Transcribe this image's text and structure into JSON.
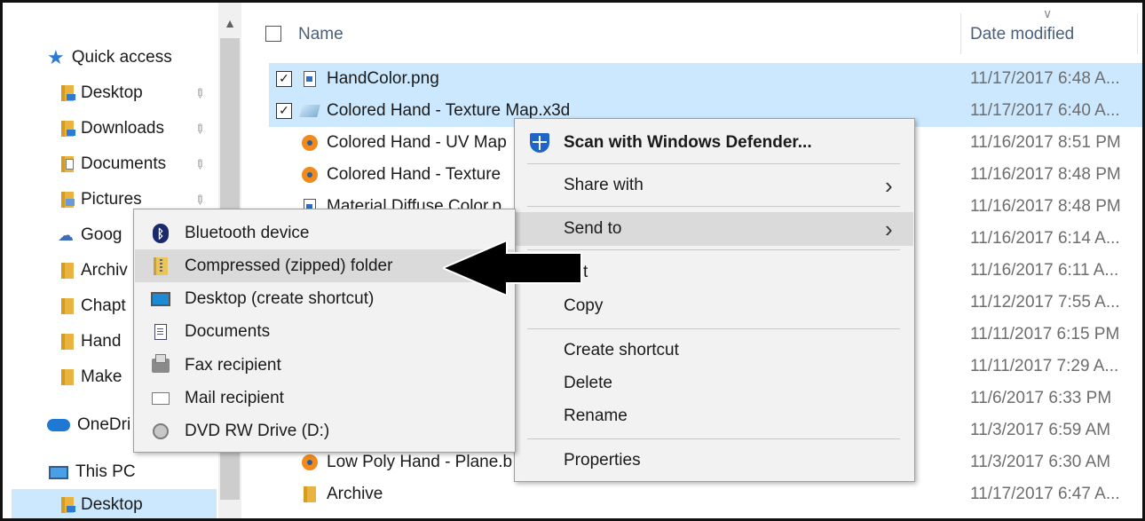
{
  "sidebar": {
    "quick_access": "Quick access",
    "items": [
      {
        "label": "Desktop",
        "pinned": true
      },
      {
        "label": "Downloads",
        "pinned": true
      },
      {
        "label": "Documents",
        "pinned": true
      },
      {
        "label": "Pictures",
        "pinned": true
      },
      {
        "label": "Goog"
      },
      {
        "label": "Archiv"
      },
      {
        "label": "Chapt"
      },
      {
        "label": "Hand"
      },
      {
        "label": "Make"
      }
    ],
    "onedrive": "OneDri",
    "this_pc": "This PC",
    "pc_desktop": "Desktop"
  },
  "header": {
    "name": "Name",
    "date_modified": "Date modified"
  },
  "files": [
    {
      "name": "HandColor.png",
      "date": "11/17/2017 6:48 A...",
      "selected": true,
      "icon": "png-icon"
    },
    {
      "name": "Colored Hand - Texture Map.x3d",
      "date": "11/17/2017 6:40 A...",
      "selected": true,
      "icon": "x3d-icon"
    },
    {
      "name": "Colored Hand - UV Map",
      "date": "11/16/2017 8:51 PM",
      "icon": "blender-icon"
    },
    {
      "name": "Colored Hand - Texture",
      "date": "11/16/2017 8:48 PM",
      "icon": "blender-icon"
    },
    {
      "name": "Material Diffuse Color.p",
      "date": "11/16/2017 8:48 PM",
      "icon": "png-icon"
    },
    {
      "name": "",
      "date": "11/16/2017 6:14 A..."
    },
    {
      "name": "",
      "date": "11/16/2017 6:11 A..."
    },
    {
      "name": "",
      "date": "11/12/2017 7:55 A..."
    },
    {
      "name": "",
      "date": "11/11/2017 6:15 PM"
    },
    {
      "name": "",
      "date": "11/11/2017 7:29 A..."
    },
    {
      "name": "",
      "date": "11/6/2017 6:33 PM"
    },
    {
      "name": "",
      "date": "11/3/2017 6:59 AM"
    },
    {
      "name": "Low Poly Hand - Plane.b",
      "date": "11/3/2017 6:30 AM",
      "icon": "blender-icon"
    },
    {
      "name": "Archive",
      "date": "11/17/2017 6:47 A...",
      "icon": "folder-icon"
    }
  ],
  "context_menu": {
    "scan": "Scan with Windows Defender...",
    "share_with": "Share with",
    "send_to": "Send to",
    "cut": "t",
    "copy": "Copy",
    "create_shortcut": "Create shortcut",
    "delete": "Delete",
    "rename": "Rename",
    "properties": "Properties"
  },
  "send_to_menu": [
    {
      "label": "Bluetooth device",
      "icon": "bluetooth-icon"
    },
    {
      "label": "Compressed (zipped) folder",
      "icon": "zip-folder-icon"
    },
    {
      "label": "Desktop (create shortcut)",
      "icon": "desktop-icon"
    },
    {
      "label": "Documents",
      "icon": "documents-icon"
    },
    {
      "label": "Fax recipient",
      "icon": "fax-icon"
    },
    {
      "label": "Mail recipient",
      "icon": "mail-icon"
    },
    {
      "label": "DVD RW Drive (D:)",
      "icon": "dvd-drive-icon"
    }
  ],
  "colors": {
    "selection": "#cce8ff",
    "menu_bg": "#f2f2f2",
    "menu_highlight": "#dadada",
    "accent": "#1f65c8"
  }
}
